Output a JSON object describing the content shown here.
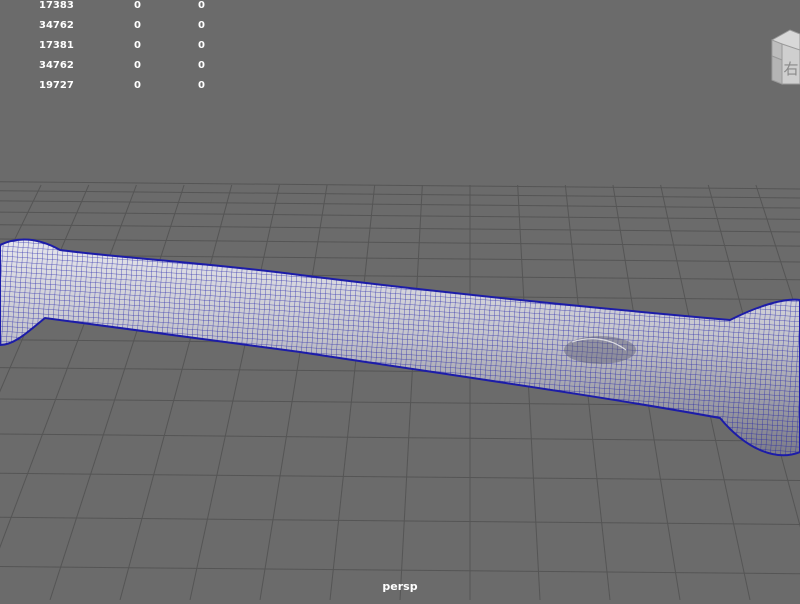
{
  "hud": {
    "rows": [
      [
        "17383",
        "0",
        "0"
      ],
      [
        "34762",
        "0",
        "0"
      ],
      [
        "17381",
        "0",
        "0"
      ],
      [
        "34762",
        "0",
        "0"
      ],
      [
        "19727",
        "0",
        "0"
      ]
    ]
  },
  "view_cube": {
    "face_label": "右"
  },
  "camera": {
    "name": "persp"
  },
  "colors": {
    "background": "#6b6b6b",
    "grid": "#555555",
    "mesh_wire": "#1c1ca8",
    "mesh_fill": "#c9c9cf"
  }
}
